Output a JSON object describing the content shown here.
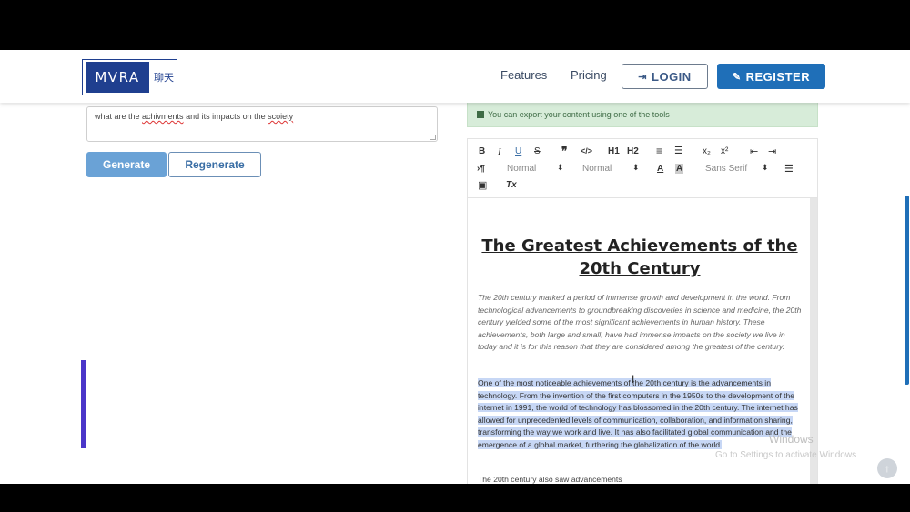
{
  "header": {
    "logo_text": "MVRA",
    "logo_cn": "聊天",
    "nav": {
      "features": "Features",
      "pricing": "Pricing"
    },
    "login_label": "LOGIN",
    "register_label": "REGISTER"
  },
  "prompt": {
    "parts": [
      "what are the ",
      "achivments",
      " and its impacts on the ",
      "scoiety"
    ],
    "generate_label": "Generate",
    "regenerate_label": "Regenerate"
  },
  "notice": {
    "text": "You can export your content using one of the tools"
  },
  "toolbar": {
    "bold": "B",
    "italic": "I",
    "underline": "U",
    "strike": "S",
    "quote": "❞",
    "code": "</>",
    "h1": "H1",
    "h2": "H2",
    "ordered": "≡",
    "bullet": "☰",
    "sub": "x₂",
    "sup": "x²",
    "outdent": "⇤",
    "indent": "⇥",
    "direction": "›¶",
    "size_select": "Normal",
    "header_select": "Normal",
    "color": "A",
    "background": "A",
    "font_select": "Sans Serif",
    "align": "☰",
    "image": "▣",
    "clean": "Tx"
  },
  "document": {
    "title": "The Greatest Achievements of the 20th Century",
    "para1": "The 20th century marked a period of immense growth and development in the world. From technological advancements to groundbreaking discoveries in science and medicine, the 20th century yielded some of the most significant achievements in human history. These achievements, both large and small, have had immense impacts on the society we live in today and it is for this reason that they are considered among the greatest of the century.",
    "para2": "One of the most noticeable achievements of the 20th century is the advancements in technology. From the invention of the first computers in the 1950s to the development of the internet in 1991, the world of technology has blossomed in the 20th century. The internet has allowed for unprecedented levels of communication, collaboration, and information sharing, transforming the way we work and live. It has also facilitated global communication and the emergence of a global market, furthering the globalization of the world.",
    "para3": "The 20th century also saw advancements"
  },
  "watermark": {
    "line1": "Windows",
    "line2": "Go to Settings to activate Windows"
  },
  "colors": {
    "brand": "#1f3f8f",
    "register": "#1f6fb8",
    "generate": "#6aa2d6",
    "notice_bg": "#d7ecd9",
    "selection": "#c7d7f5"
  }
}
